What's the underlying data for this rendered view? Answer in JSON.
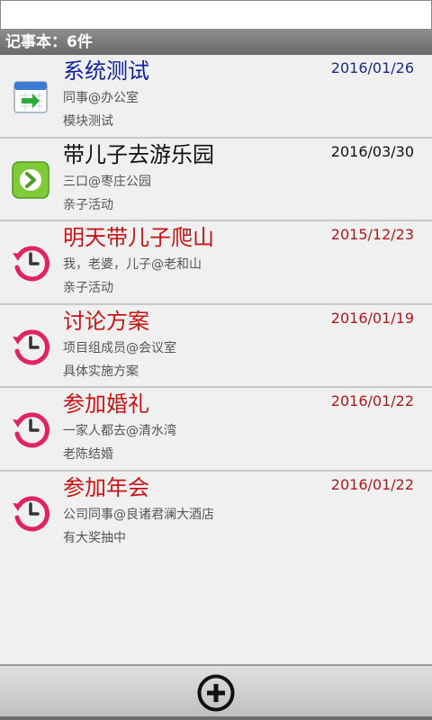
{
  "header": {
    "title": "记事本：6件"
  },
  "colors": {
    "blue_title": "#0f1fa0",
    "black_title": "#111111",
    "red_title": "#c81414",
    "blue_date": "#1b2a8a",
    "red_date": "#b01818"
  },
  "items": [
    {
      "title": "系统测试",
      "date": "2016/01/26",
      "subtitle": "同事@办公室",
      "note": "模块测试",
      "icon": "calendar-import-icon",
      "title_color": "#0f1fa0",
      "date_color": "#1b2a8a"
    },
    {
      "title": "带儿子去游乐园",
      "date": "2016/03/30",
      "subtitle": "三口@枣庄公园",
      "note": "亲子活动",
      "icon": "forward-arrow-icon",
      "title_color": "#111111",
      "date_color": "#111111"
    },
    {
      "title": "明天带儿子爬山",
      "date": "2015/12/23",
      "subtitle": "我，老婆，儿子@老和山",
      "note": "亲子活动",
      "icon": "clock-history-icon",
      "title_color": "#c81414",
      "date_color": "#b01818"
    },
    {
      "title": "讨论方案",
      "date": "2016/01/19",
      "subtitle": "项目组成员@会议室",
      "note": "具体实施方案",
      "icon": "clock-history-icon",
      "title_color": "#c81414",
      "date_color": "#b01818"
    },
    {
      "title": "参加婚礼",
      "date": "2016/01/22",
      "subtitle": "一家人都去@清水湾",
      "note": "老陈结婚",
      "icon": "clock-history-icon",
      "title_color": "#c81414",
      "date_color": "#b01818"
    },
    {
      "title": "参加年会",
      "date": "2016/01/22",
      "subtitle": "公司同事@良诸君澜大酒店",
      "note": "有大奖抽中",
      "icon": "clock-history-icon",
      "title_color": "#c81414",
      "date_color": "#b01818"
    }
  ],
  "toolbar": {
    "add_icon": "plus-circle-icon"
  }
}
